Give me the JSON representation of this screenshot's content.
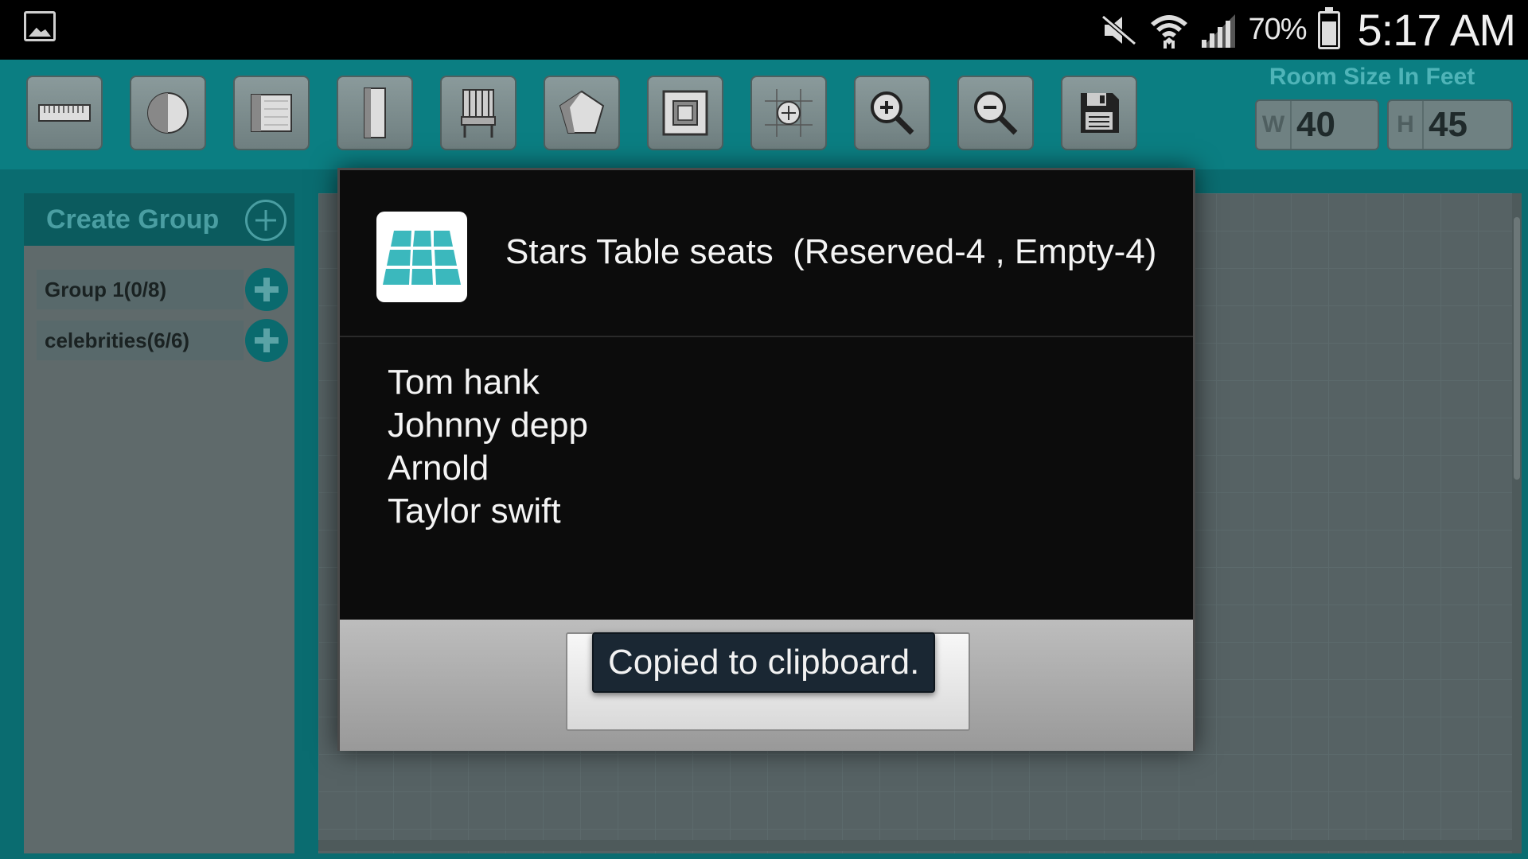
{
  "status_bar": {
    "battery_percent": "70%",
    "time": "5:17 AM"
  },
  "toolbar": {
    "tools": [
      {
        "name": "wall-tool",
        "icon": "wall-icon"
      },
      {
        "name": "round-table-tool",
        "icon": "circle-half-icon"
      },
      {
        "name": "square-table-tool",
        "icon": "square-half-icon"
      },
      {
        "name": "long-table-tool",
        "icon": "rectangle-tall-icon"
      },
      {
        "name": "chair-tool",
        "icon": "chair-icon"
      },
      {
        "name": "pentagon-tool",
        "icon": "pentagon-icon"
      },
      {
        "name": "fit-screen-tool",
        "icon": "fit-screen-icon"
      },
      {
        "name": "grid-center-tool",
        "icon": "grid-crosshair-icon"
      },
      {
        "name": "zoom-in-tool",
        "icon": "zoom-in-icon"
      },
      {
        "name": "zoom-out-tool",
        "icon": "zoom-out-icon"
      },
      {
        "name": "save-tool",
        "icon": "floppy-disk-icon"
      }
    ],
    "room_size": {
      "label": "Room Size In Feet",
      "width_prefix": "W",
      "width_value": "40",
      "height_prefix": "H",
      "height_value": "45"
    }
  },
  "sidebar": {
    "title": "Create Group",
    "groups": [
      {
        "label": "Group 1(0/8)"
      },
      {
        "label": "celebrities(6/6)"
      }
    ]
  },
  "dialog": {
    "title": "Stars Table seats  (Reserved-4 , Empty-4)",
    "guests": [
      "Tom hank",
      "Johnny depp",
      "Arnold",
      "Taylor swift"
    ],
    "icon_color": "#3bb8bd"
  },
  "toast": {
    "message": "Copied to clipboard."
  }
}
